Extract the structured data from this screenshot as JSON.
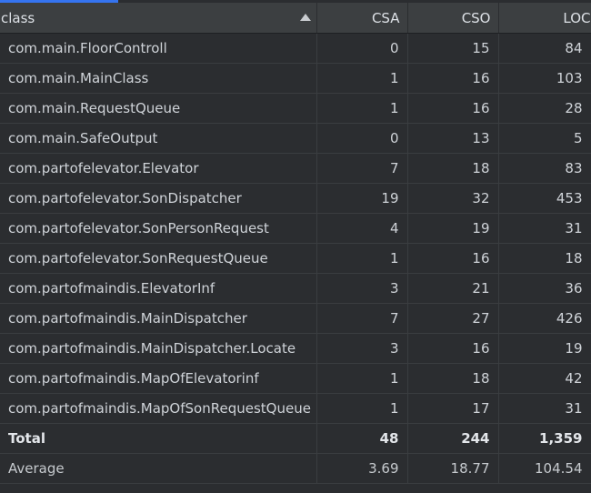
{
  "table": {
    "headers": {
      "class": "class",
      "csa": "CSA",
      "cso": "CSO",
      "loc": "LOC"
    },
    "rows": [
      {
        "class": "com.main.FloorControll",
        "csa": "0",
        "cso": "15",
        "loc": "84"
      },
      {
        "class": "com.main.MainClass",
        "csa": "1",
        "cso": "16",
        "loc": "103"
      },
      {
        "class": "com.main.RequestQueue",
        "csa": "1",
        "cso": "16",
        "loc": "28"
      },
      {
        "class": "com.main.SafeOutput",
        "csa": "0",
        "cso": "13",
        "loc": "5"
      },
      {
        "class": "com.partofelevator.Elevator",
        "csa": "7",
        "cso": "18",
        "loc": "83"
      },
      {
        "class": "com.partofelevator.SonDispatcher",
        "csa": "19",
        "cso": "32",
        "loc": "453"
      },
      {
        "class": "com.partofelevator.SonPersonRequest",
        "csa": "4",
        "cso": "19",
        "loc": "31"
      },
      {
        "class": "com.partofelevator.SonRequestQueue",
        "csa": "1",
        "cso": "16",
        "loc": "18"
      },
      {
        "class": "com.partofmaindis.ElevatorInf",
        "csa": "3",
        "cso": "21",
        "loc": "36"
      },
      {
        "class": "com.partofmaindis.MainDispatcher",
        "csa": "7",
        "cso": "27",
        "loc": "426"
      },
      {
        "class": "com.partofmaindis.MainDispatcher.Locate",
        "csa": "3",
        "cso": "16",
        "loc": "19"
      },
      {
        "class": "com.partofmaindis.MapOfElevatorinf",
        "csa": "1",
        "cso": "18",
        "loc": "42"
      },
      {
        "class": "com.partofmaindis.MapOfSonRequestQueue",
        "csa": "1",
        "cso": "17",
        "loc": "31"
      }
    ],
    "total": {
      "label": "Total",
      "csa": "48",
      "cso": "244",
      "loc": "1,359"
    },
    "average": {
      "label": "Average",
      "csa": "3.69",
      "cso": "18.77",
      "loc": "104.54"
    }
  },
  "icons": {
    "sort": "sort-ascending-icon"
  },
  "colors": {
    "background": "#2b2d30",
    "header": "#3c3f41",
    "accent": "#3574f0",
    "text": "#cfd3d8"
  }
}
